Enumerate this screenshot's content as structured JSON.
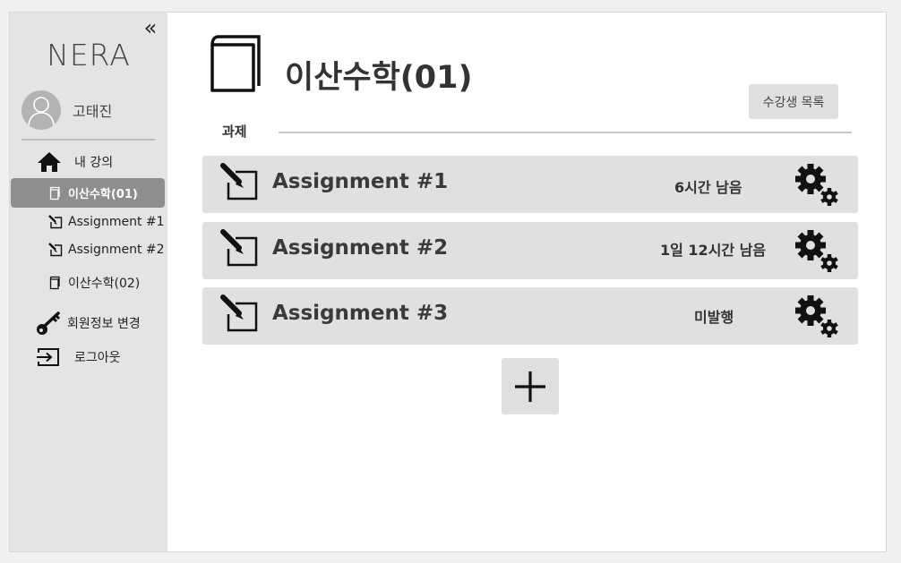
{
  "sidebar": {
    "collapse_glyph": "«",
    "brand": "NERA",
    "user_name": "고태진",
    "nav": {
      "my_courses": "내 강의",
      "course1": "이산수학(01)",
      "assignment1": "Assignment #1",
      "assignment2": "Assignment #2",
      "course2": "이산수학(02)",
      "edit_profile": "회원정보 변경",
      "logout": "로그아웃"
    }
  },
  "main": {
    "course_title": "이산수학(01)",
    "students_button": "수강생 목록",
    "section_label": "과제",
    "assignments": [
      {
        "title": "Assignment #1",
        "status": "6시간 남음"
      },
      {
        "title": "Assignment #2",
        "status": "1일 12시간 남음"
      },
      {
        "title": "Assignment #3",
        "status": "미발행"
      }
    ]
  },
  "icons": {
    "home": "home-icon",
    "book": "book-icon",
    "edit": "edit-icon",
    "key": "key-icon",
    "logout": "logout-icon",
    "gear": "gears-icon",
    "add": "plus-icon"
  },
  "colors": {
    "sidebar_bg": "#e4e4e4",
    "active_item_bg": "#8e8e8e",
    "card_bg": "#e0e0e0"
  }
}
